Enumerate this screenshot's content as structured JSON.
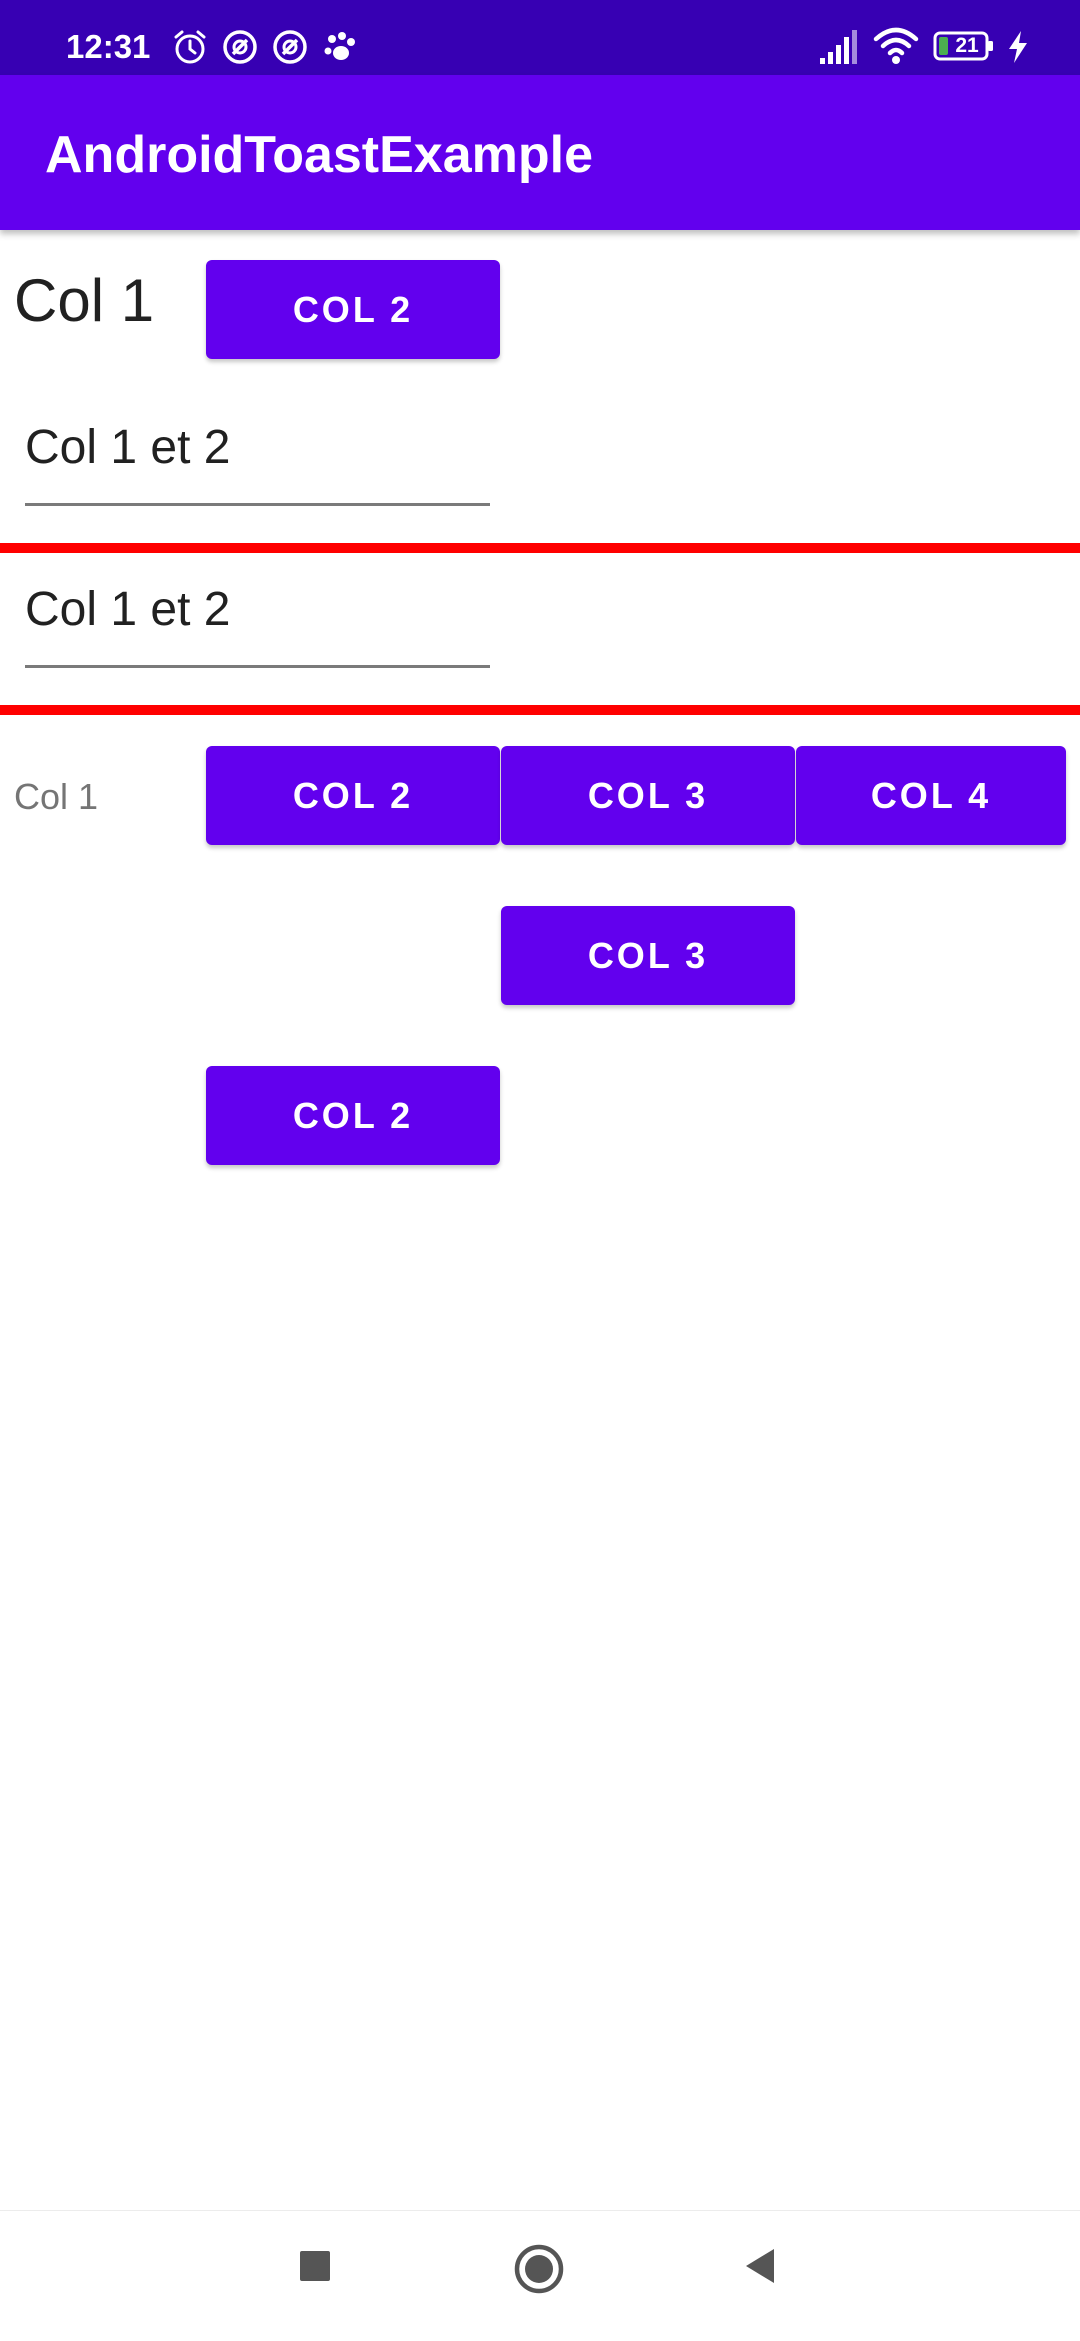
{
  "status_bar": {
    "time": "12:31",
    "battery": "21",
    "icons": [
      "alarm-icon",
      "notification-icon",
      "notification-icon",
      "paw-icon",
      "signal-icon",
      "wifi-icon",
      "battery-icon",
      "charging-icon"
    ]
  },
  "app_bar": {
    "title": "AndroidToastExample"
  },
  "rows": {
    "row1": {
      "label": "Col 1",
      "button": "COL 2"
    },
    "edit1": {
      "value": "Col 1 et 2"
    },
    "edit2": {
      "value": "Col 1 et 2"
    },
    "row2": {
      "label": "Col 1",
      "button_col2": "COL 2",
      "button_col3": "COL 3",
      "button_col4": "COL 4"
    },
    "row3": {
      "button": "COL 3"
    },
    "row4": {
      "button": "COL 2"
    }
  },
  "nav_bar": {
    "icons": [
      "recents-icon",
      "home-icon",
      "back-icon"
    ]
  },
  "colors": {
    "status_bar": "#3700B3",
    "primary": "#6200EE",
    "separator": "#FF0000"
  }
}
